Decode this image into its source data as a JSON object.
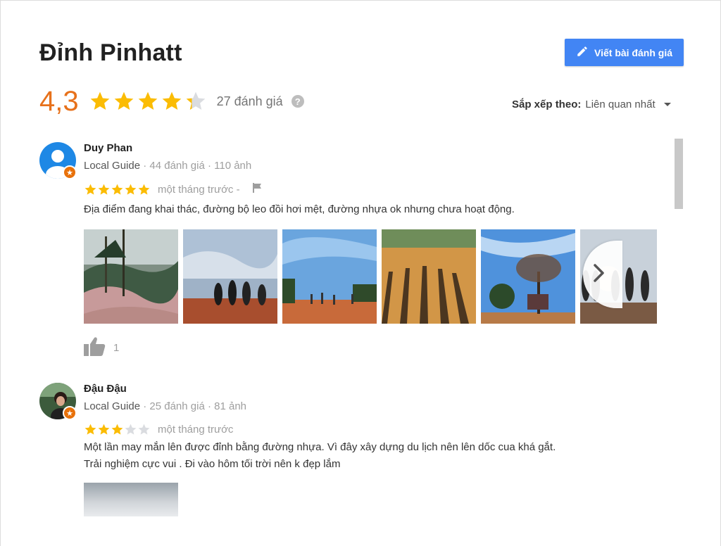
{
  "place": {
    "title": "Đỉnh Pinhatt",
    "write_review_label": "Viết bài đánh giá",
    "rating": "4,3",
    "rating_value": 4.3,
    "reviews_count": "27 đánh giá",
    "help_glyph": "?"
  },
  "sort": {
    "label": "Sắp xếp theo:",
    "value": "Liên quan nhất"
  },
  "reviews": [
    {
      "name": "Duy Phan",
      "badge": "Local Guide",
      "meta": " · 44 đánh giá · 110 ảnh",
      "stars": 5,
      "time": "một tháng trước -",
      "text_lines": [
        "Địa điểm đang khai thác, đường bộ leo đồi hơi mệt, đường nhựa ok nhưng chưa hoạt động."
      ],
      "photo_count": 6,
      "likes": "1"
    },
    {
      "name": "Đậu Đậu",
      "badge": "Local Guide",
      "meta": " · 25 đánh giá · 81 ảnh",
      "stars": 3,
      "time": "một tháng trước",
      "text_lines": [
        "Một lần may mắn lên được đỉnh bằng đường nhựa. Vì đây xây dựng du lịch nên lên dốc cua khá gắt.",
        "Trải nghiệm cực vui .  Đi vào hôm tối trời nên k đẹp lắm"
      ],
      "photo_count": 1
    }
  ],
  "colors": {
    "accent": "#4285f4",
    "rating": "#e7711b",
    "star": "#fbbc04",
    "star_empty": "#dadce0",
    "guide_badge": "#e8710a"
  },
  "icons": {
    "edit": "pencil-icon",
    "help": "help-icon",
    "sort": "caret-down-icon",
    "flag": "flag-icon",
    "like": "thumbs-up-icon",
    "next": "chevron-right-icon"
  }
}
